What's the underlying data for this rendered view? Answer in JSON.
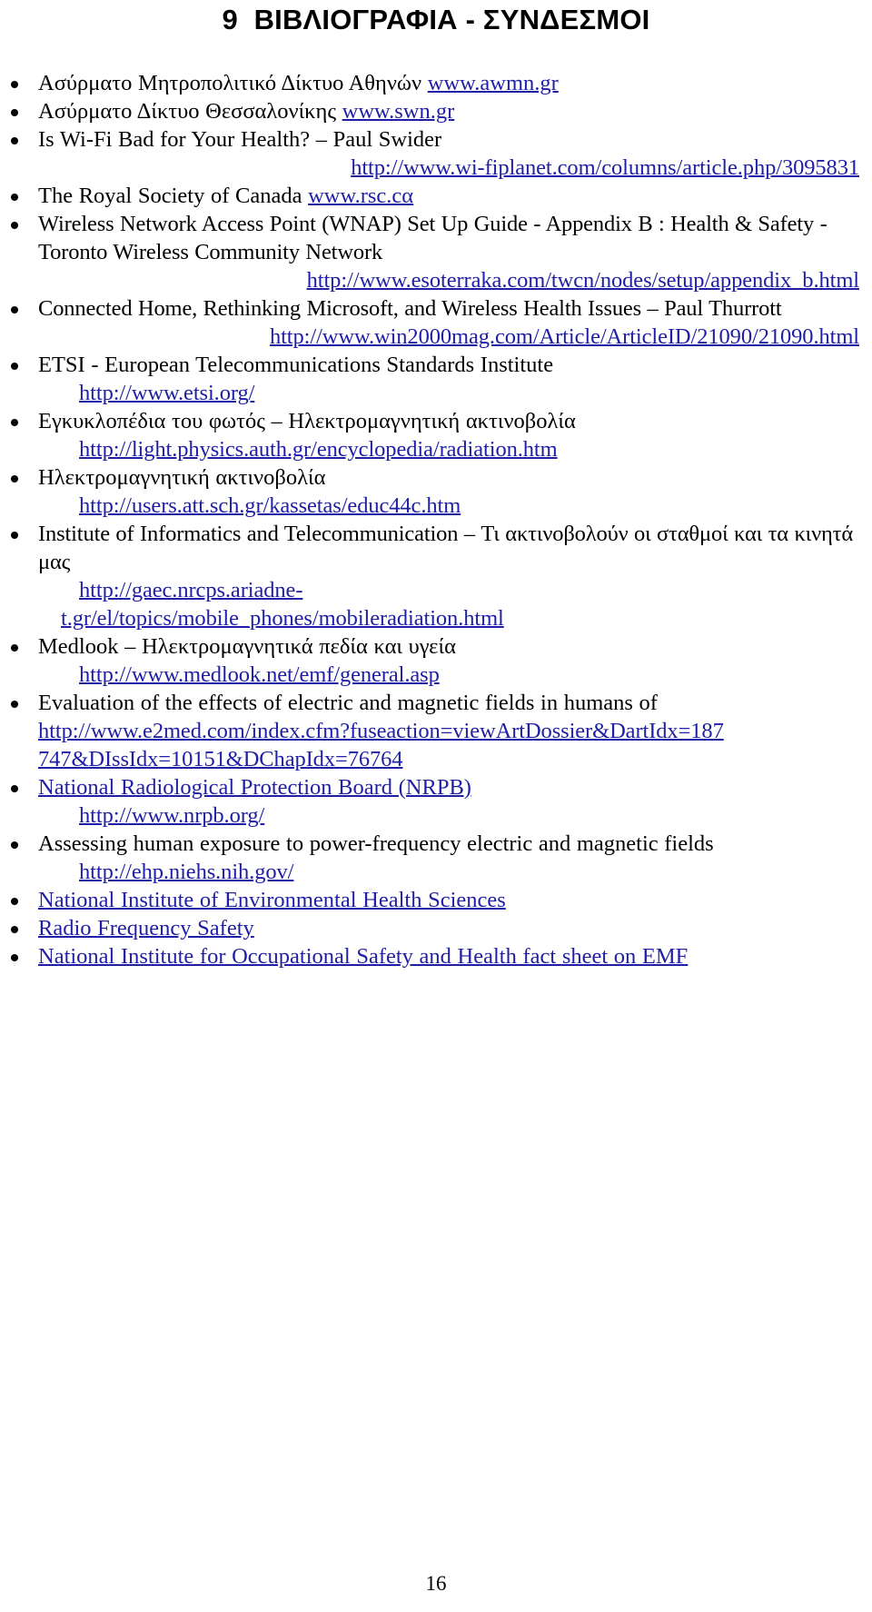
{
  "document": {
    "title": "9  ΒΙΒΛΙΟΓΡΑΦΙΑ - ΣΥΝΔΕΣΜΟΙ",
    "page_number": "16",
    "link_color": "#1f1fa5",
    "text_color": "#000000",
    "background_color": "#ffffff"
  },
  "entries": [
    {
      "id": "awmn",
      "label": "Ασύρματο Μητροπολιτικό Δίκτυο Αθηνών ",
      "inline_url": "www.awmn.gr",
      "url_lines": []
    },
    {
      "id": "swn",
      "label": "Ασύρματο Δίκτυο Θεσσαλονίκης ",
      "inline_url": "www.swn.gr",
      "url_lines": []
    },
    {
      "id": "wifi-bad-health",
      "label": "Is Wi-Fi Bad for Your Health? – Paul Swider",
      "inline_url": "",
      "url_lines": [
        "http://www.wi-fiplanet.com/columns/article.php/3095831"
      ]
    },
    {
      "id": "royal-society-canada",
      "label": "The Royal Society of Canada ",
      "inline_url": "www.rsc.cα",
      "url_lines": []
    },
    {
      "id": "wnap-toronto",
      "label": "Wireless Network Access Point (WNAP) Set Up Guide - Appendix B : Health & Safety - Toronto Wireless Community Network",
      "inline_url": "",
      "url_lines": [
        "http://www.esoterraka.com/twcn/nodes/setup/appendix_b.html"
      ]
    },
    {
      "id": "connected-home-thurrott",
      "label": "Connected Home, Rethinking Microsoft, and Wireless Health Issues – Paul Thurrott",
      "inline_url": "",
      "url_lines": [
        "http://www.win2000mag.com/Article/ArticleID/21090/21090.html"
      ]
    },
    {
      "id": "etsi",
      "label": "ETSI - European Telecommunications Standards Institute",
      "inline_url": "",
      "url_lines": [
        "http://www.etsi.org/"
      ]
    },
    {
      "id": "egkyklopedia-fotos",
      "label": "Εγκυκλοπέδια του φωτός – Ηλεκτρομαγνητική ακτινοβολία",
      "inline_url": "",
      "url_lines": [
        "http://light.physics.auth.gr/encyclopedia/radiation.htm"
      ]
    },
    {
      "id": "ilektromagnitiki-aktinovolia",
      "label": "Ηλεκτρομαγνητική ακτινοβολία",
      "inline_url": "",
      "url_lines": [
        "http://users.att.sch.gr/kassetas/educ44c.htm"
      ]
    },
    {
      "id": "institute-informatics",
      "label": "Institute of Informatics and Telecommunication – Τι ακτινοβολούν οι σταθμοί και τα κινητά μας",
      "inline_url": "",
      "url_lines": [
        "http://gaec.nrcps.ariadne-",
        "t.gr/el/topics/mobile_phones/mobileradiation.html"
      ]
    },
    {
      "id": "medlook",
      "label": "Medlook – Ηλεκτρομαγνητικά πεδία και υγεία",
      "inline_url": "",
      "url_lines": [
        "http://www.medlook.net/emf/general.asp"
      ]
    },
    {
      "id": "e2med-evaluation",
      "label": "Evaluation of the effects of electric and magnetic fields in humans of",
      "inline_url": "",
      "url_lines": [
        "http://www.e2med.com/index.cfm?fuseaction=viewArtDossier&DartIdx=187",
        "747&DIssIdx=10151&DChapIdx=76764"
      ]
    },
    {
      "id": "nrpb",
      "label": "National Radiological Protection Board (NRPB)",
      "label_is_link": true,
      "inline_url": "",
      "url_lines": [
        "http://www.nrpb.org/"
      ]
    },
    {
      "id": "assessing-human-exposure",
      "label": "Assessing human exposure to power-frequency electric and magnetic fields",
      "inline_url": "",
      "url_lines": [
        "http://ehp.niehs.nih.gov/"
      ]
    },
    {
      "id": "niehs",
      "label": "National Institute of Environmental Health Sciences",
      "label_is_link": true,
      "inline_url": "",
      "url_lines": []
    },
    {
      "id": "radio-frequency-safety",
      "label": "Radio Frequency Safety",
      "label_is_link": true,
      "inline_url": "",
      "url_lines": []
    },
    {
      "id": "niosh-emf",
      "label": "National Institute for Occupational Safety and Health fact sheet on EMF",
      "label_is_link": true,
      "inline_url": "",
      "url_lines": []
    }
  ]
}
